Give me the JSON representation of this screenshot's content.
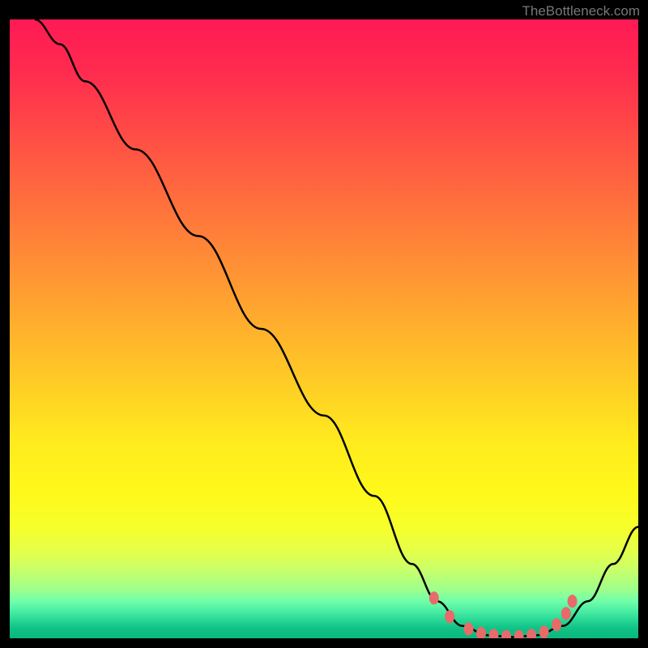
{
  "watermark": "TheBottleneck.com",
  "chart_data": {
    "type": "line",
    "title": "",
    "xlabel": "",
    "ylabel": "",
    "xlim": [
      0,
      100
    ],
    "ylim": [
      0,
      100
    ],
    "curve": [
      {
        "x": 4,
        "y": 100
      },
      {
        "x": 8,
        "y": 96
      },
      {
        "x": 12,
        "y": 90
      },
      {
        "x": 20,
        "y": 79
      },
      {
        "x": 30,
        "y": 65
      },
      {
        "x": 40,
        "y": 50
      },
      {
        "x": 50,
        "y": 36
      },
      {
        "x": 58,
        "y": 23
      },
      {
        "x": 64,
        "y": 12
      },
      {
        "x": 68,
        "y": 6
      },
      {
        "x": 72,
        "y": 2
      },
      {
        "x": 76,
        "y": 0.5
      },
      {
        "x": 80,
        "y": 0.2
      },
      {
        "x": 84,
        "y": 0.5
      },
      {
        "x": 88,
        "y": 2
      },
      {
        "x": 92,
        "y": 6
      },
      {
        "x": 96,
        "y": 12
      },
      {
        "x": 100,
        "y": 18
      }
    ],
    "dots": [
      {
        "x": 67.5,
        "y": 6.5
      },
      {
        "x": 70,
        "y": 3.5
      },
      {
        "x": 73,
        "y": 1.5
      },
      {
        "x": 75,
        "y": 0.8
      },
      {
        "x": 77,
        "y": 0.5
      },
      {
        "x": 79,
        "y": 0.3
      },
      {
        "x": 81,
        "y": 0.3
      },
      {
        "x": 83,
        "y": 0.5
      },
      {
        "x": 85,
        "y": 1.0
      },
      {
        "x": 87,
        "y": 2.2
      },
      {
        "x": 88.5,
        "y": 4.0
      },
      {
        "x": 89.5,
        "y": 6.0
      }
    ],
    "gradient_stops": [
      {
        "pos": 0,
        "color": "#ff1a54"
      },
      {
        "pos": 50,
        "color": "#ffca26"
      },
      {
        "pos": 80,
        "color": "#fff81a"
      },
      {
        "pos": 100,
        "color": "#0ab87e"
      }
    ]
  }
}
